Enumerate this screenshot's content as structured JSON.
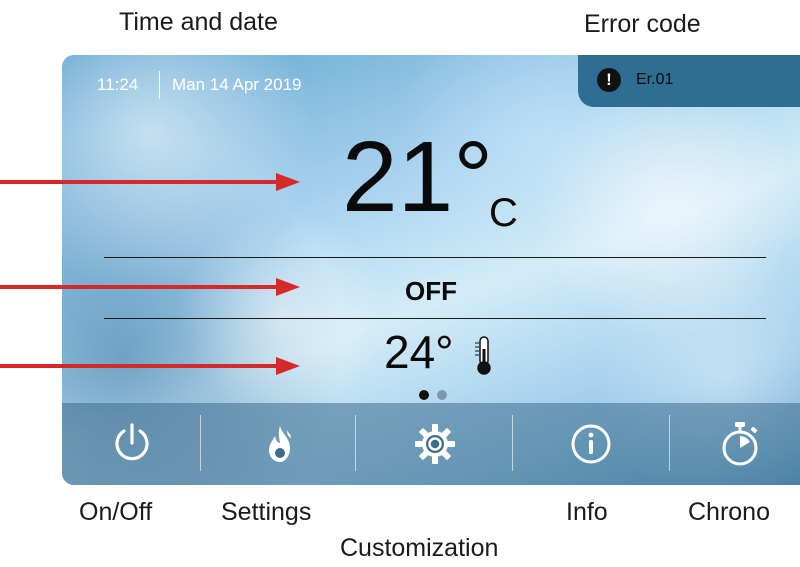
{
  "callouts": {
    "time_and_date": "Time and date",
    "error_code": "Error code"
  },
  "screen": {
    "time": "11:24",
    "date": "Man 14 Apr 2019",
    "error": {
      "icon": "exclamation-icon",
      "code": "Er.01"
    },
    "temperature": {
      "value": "21°",
      "unit": "C"
    },
    "status": "OFF",
    "setpoint": {
      "value": "24°",
      "icon": "thermometer-icon"
    },
    "page_dots": {
      "count": 2,
      "active_index": 0
    },
    "nav": [
      {
        "icon": "power-icon",
        "label": "On/Off"
      },
      {
        "icon": "flame-icon",
        "label": "Settings"
      },
      {
        "icon": "gear-icon",
        "label": "Customization"
      },
      {
        "icon": "info-icon",
        "label": "Info"
      },
      {
        "icon": "stopwatch-icon",
        "label": "Chrono"
      }
    ]
  },
  "colors": {
    "arrow": "#d42a2a",
    "error_box": "#2f6d93",
    "nav_bar": "#3c6e8c"
  }
}
